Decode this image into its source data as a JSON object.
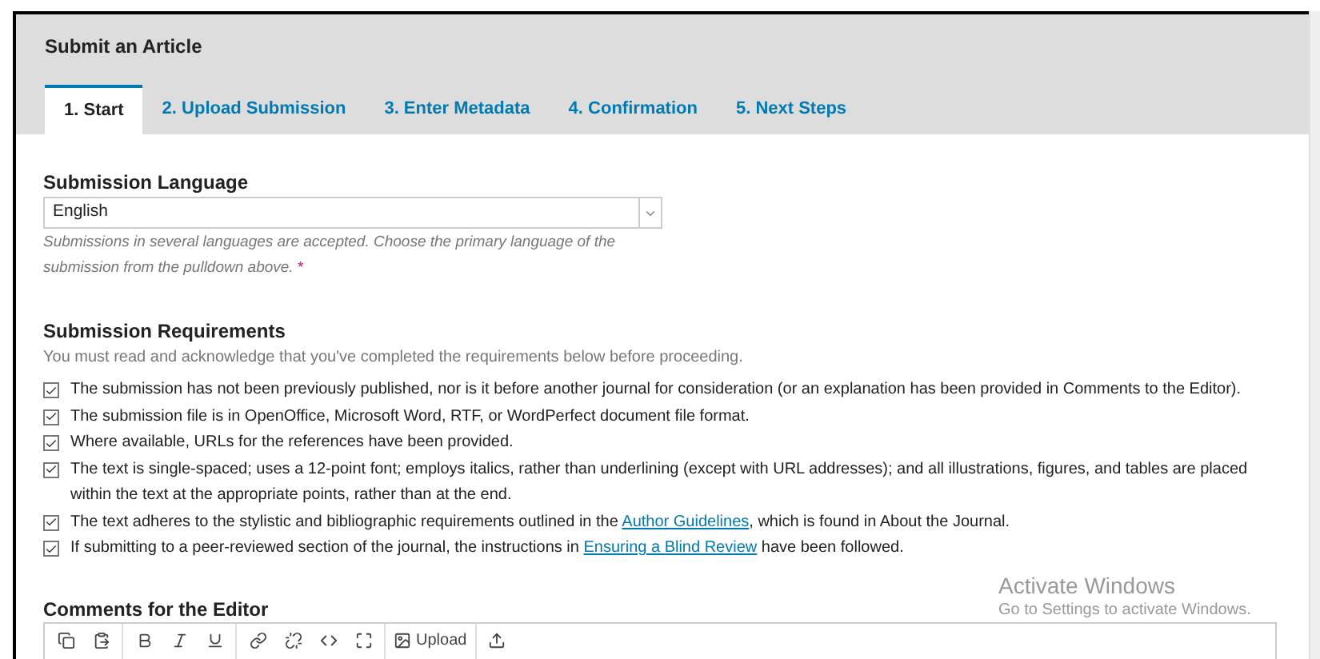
{
  "page_title": "Submit an Article",
  "tabs": [
    {
      "label": "1. Start",
      "selected": true
    },
    {
      "label": "2. Upload Submission",
      "selected": false
    },
    {
      "label": "3. Enter Metadata",
      "selected": false
    },
    {
      "label": "4. Confirmation",
      "selected": false
    },
    {
      "label": "5. Next Steps",
      "selected": false
    }
  ],
  "language": {
    "heading": "Submission Language",
    "value": "English",
    "help": "Submissions in several languages are accepted. Choose the primary language of the submission from the pulldown above.",
    "required_mark": "*"
  },
  "requirements": {
    "heading": "Submission Requirements",
    "intro": "You must read and acknowledge that you've completed the requirements below before proceeding.",
    "items": [
      {
        "checked": true,
        "parts": [
          {
            "kind": "text",
            "text": "The submission has not been previously published, nor is it before another journal for consideration (or an explanation has been provided in Comments to the Editor)."
          }
        ]
      },
      {
        "checked": true,
        "parts": [
          {
            "kind": "text",
            "text": "The submission file is in OpenOffice, Microsoft Word, RTF, or WordPerfect document file format."
          }
        ]
      },
      {
        "checked": true,
        "parts": [
          {
            "kind": "text",
            "text": "Where available, URLs for the references have been provided."
          }
        ]
      },
      {
        "checked": true,
        "parts": [
          {
            "kind": "text",
            "text": "The text is single-spaced; uses a 12-point font; employs italics, rather than underlining (except with URL addresses); and all illustrations, figures, and tables are placed within the text at the appropriate points, rather than at the end."
          }
        ]
      },
      {
        "checked": true,
        "parts": [
          {
            "kind": "text",
            "text": "The text adheres to the stylistic and bibliographic requirements outlined in the "
          },
          {
            "kind": "link",
            "text": "Author Guidelines"
          },
          {
            "kind": "text",
            "text": ", which is found in About the Journal."
          }
        ]
      },
      {
        "checked": true,
        "parts": [
          {
            "kind": "text",
            "text": "If submitting to a peer-reviewed section of the journal, the instructions in "
          },
          {
            "kind": "link",
            "text": "Ensuring a Blind Review"
          },
          {
            "kind": "text",
            "text": " have been followed."
          }
        ]
      }
    ]
  },
  "comments": {
    "heading": "Comments for the Editor",
    "upload_label": "Upload"
  },
  "os_overlay": {
    "title": "Activate Windows",
    "subtitle": "Go to Settings to activate Windows."
  }
}
